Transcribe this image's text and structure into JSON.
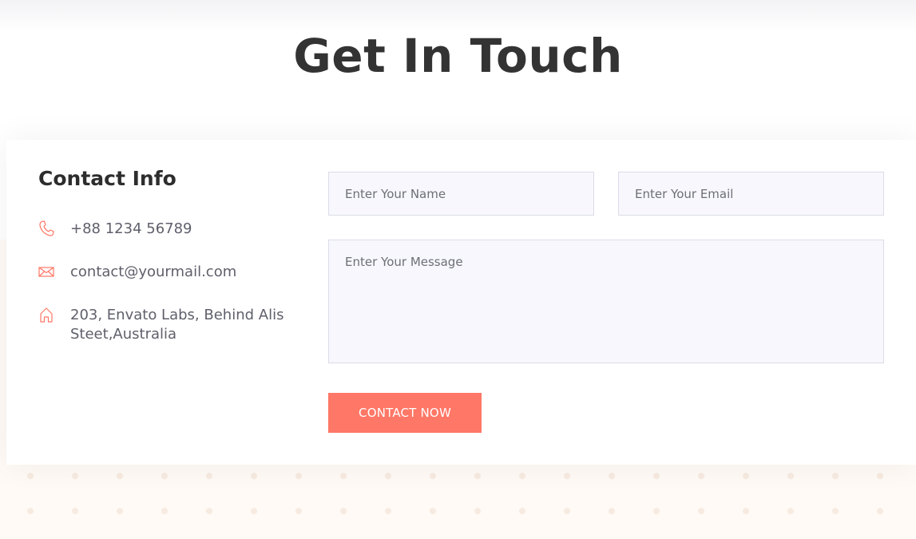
{
  "header": {
    "title": "Get In Touch"
  },
  "contact_info": {
    "heading": "Contact Info",
    "items": [
      {
        "icon": "phone-icon",
        "text": "+88 1234 56789"
      },
      {
        "icon": "mail-icon",
        "text": "contact@yourmail.com"
      },
      {
        "icon": "home-icon",
        "text": "203, Envato Labs, Behind Alis Steet,Australia"
      }
    ]
  },
  "form": {
    "name_placeholder": "Enter Your Name",
    "email_placeholder": "Enter Your Email",
    "message_placeholder": "Enter Your Message",
    "submit_label": "CONTACT NOW"
  },
  "colors": {
    "accent": "#ff7766",
    "heading": "#333333",
    "text": "#5f5f6b",
    "field_bg": "#f7f7fd",
    "field_border": "#dcdcea"
  }
}
